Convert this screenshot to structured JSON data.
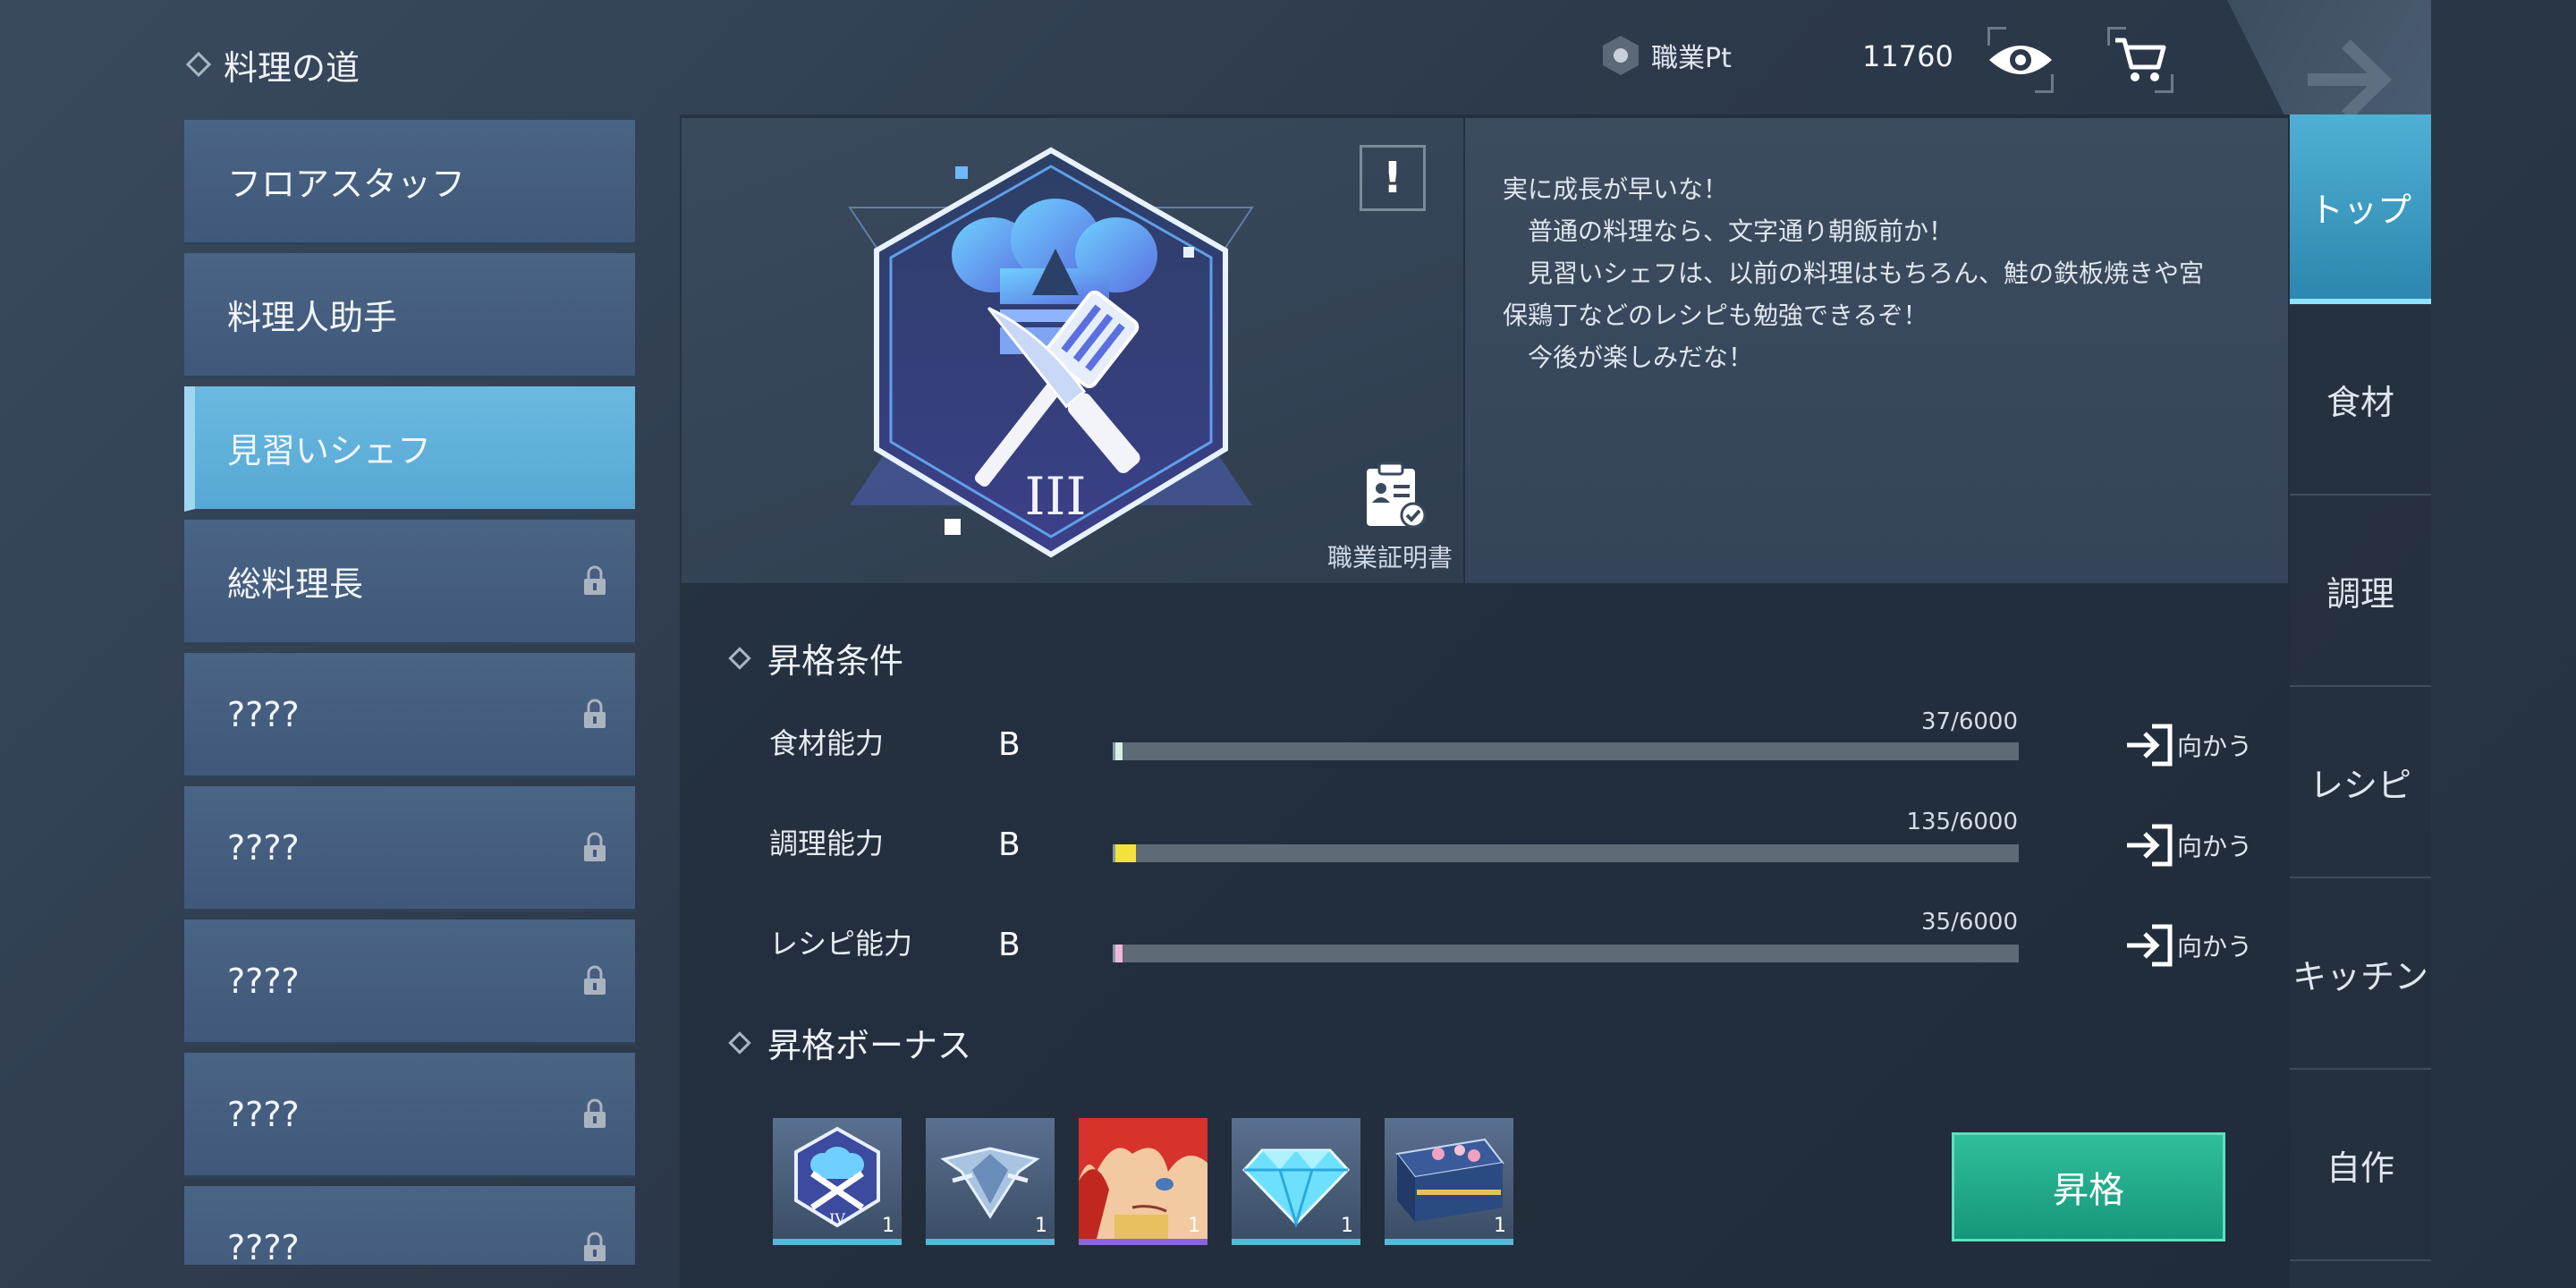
{
  "header": {
    "title": "料理の道",
    "points_label": "職業Pt",
    "points_value": "11760"
  },
  "job_list": [
    {
      "label": "フロアスタッフ",
      "locked": false,
      "active": false
    },
    {
      "label": "料理人助手",
      "locked": false,
      "active": false
    },
    {
      "label": "見習いシェフ",
      "locked": false,
      "active": true
    },
    {
      "label": "総料理長",
      "locked": true,
      "active": false
    },
    {
      "label": "????",
      "locked": true,
      "active": false
    },
    {
      "label": "????",
      "locked": true,
      "active": false
    },
    {
      "label": "????",
      "locked": true,
      "active": false
    },
    {
      "label": "????",
      "locked": true,
      "active": false
    },
    {
      "label": "????",
      "locked": true,
      "active": false
    }
  ],
  "badge": {
    "rank_numeral": "III",
    "certificate_label": "職業証明書",
    "alert_label": "!"
  },
  "description": "実に成長が早いな！\n　普通の料理なら、文字通り朝飯前か！\n　見習いシェフは、以前の料理はもちろん、鮭の鉄板焼きや宮\n保鶏丁などのレシピも勉強できるぞ！\n　今後が楽しみだな！",
  "conditions": {
    "title": "昇格条件",
    "stats": [
      {
        "name": "食材能力",
        "rank": "B",
        "progress": "37/6000",
        "current": 37,
        "max": 6000,
        "fill_color": "#d8f0e0",
        "go_label": "向かう"
      },
      {
        "name": "調理能力",
        "rank": "B",
        "progress": "135/6000",
        "current": 135,
        "max": 6000,
        "fill_color": "#f4e23a",
        "go_label": "向かう"
      },
      {
        "name": "レシピ能力",
        "rank": "B",
        "progress": "35/6000",
        "current": 35,
        "max": 6000,
        "fill_color": "#f0b8d8",
        "go_label": "向かう"
      }
    ]
  },
  "bonus": {
    "title": "昇格ボーナス",
    "items": [
      {
        "icon": "chef-badge-iv-icon",
        "count": "1",
        "sub": "IV"
      },
      {
        "icon": "silver-crest-icon",
        "count": "1"
      },
      {
        "icon": "character-portrait-icon",
        "count": "1"
      },
      {
        "icon": "diamond-gem-icon",
        "count": "1"
      },
      {
        "icon": "bento-box-icon",
        "count": "1"
      }
    ]
  },
  "promote_button": "昇格",
  "right_tabs": [
    {
      "label": "トップ",
      "active": true
    },
    {
      "label": "食材",
      "active": false
    },
    {
      "label": "調理",
      "active": false
    },
    {
      "label": "レシピ",
      "active": false
    },
    {
      "label": "キッチン",
      "active": false
    },
    {
      "label": "自作",
      "active": false
    }
  ],
  "colors": {
    "accent_blue": "#56a8d4",
    "promote_green": "#17967a"
  }
}
